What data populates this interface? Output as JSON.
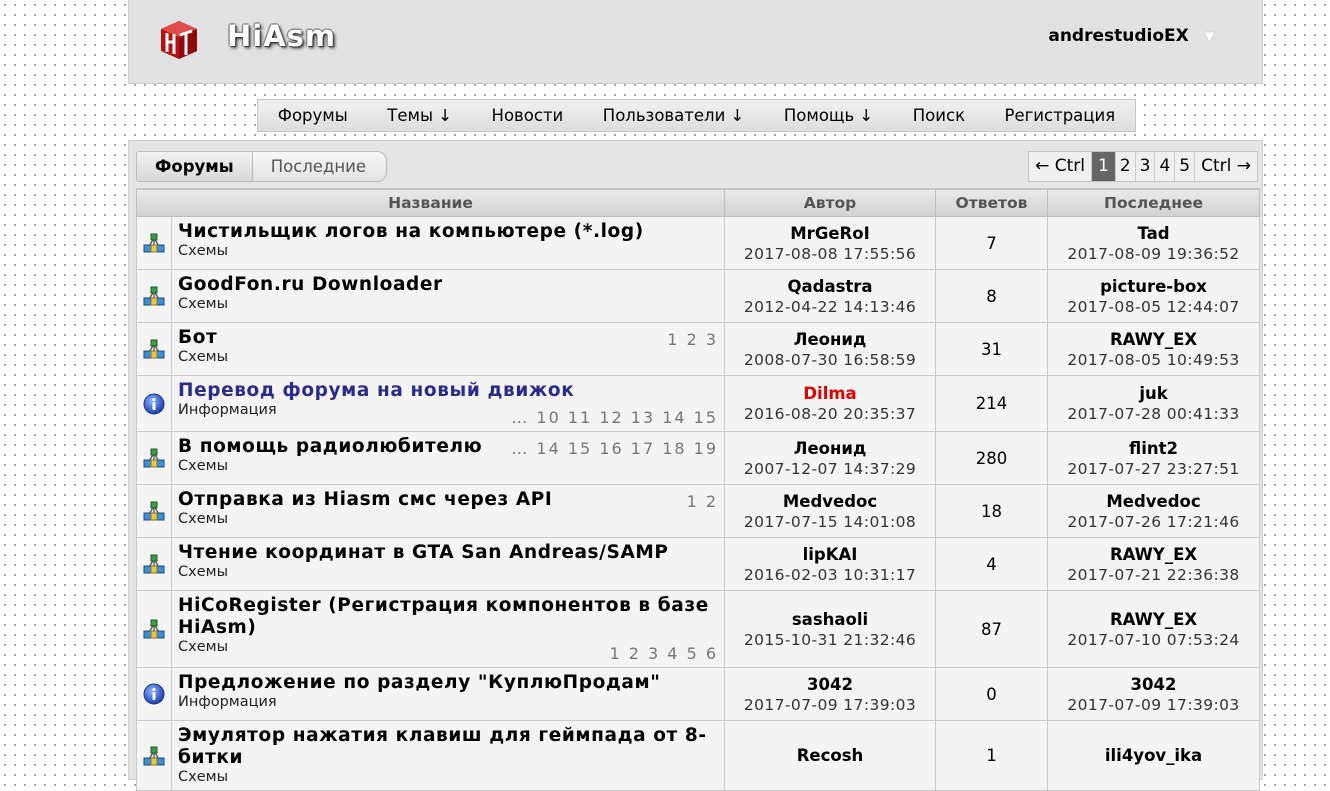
{
  "header": {
    "site_name": "HiAsm",
    "user_name": "andrestudioEX",
    "user_caret": "▼"
  },
  "nav": [
    "Форумы",
    "Темы ↓",
    "Новости",
    "Пользователи ↓",
    "Помощь ↓",
    "Поиск",
    "Регистрация"
  ],
  "tabs": {
    "active": "Форумы",
    "other": "Последние"
  },
  "pager": {
    "prev": "← Ctrl",
    "pages": [
      "1",
      "2",
      "3",
      "4",
      "5"
    ],
    "current": "1",
    "next": "Ctrl →"
  },
  "table": {
    "headers": [
      "Название",
      "Автор",
      "Ответов",
      "Последнее"
    ],
    "rows": [
      {
        "icon": "schema",
        "title": "Чистильщик логов на компьютере (*.log)",
        "category": "Схемы",
        "pages": "",
        "pages_pos": "top",
        "author": "MrGeRoI",
        "author_color": "",
        "created": "2017-08-08 17:55:56",
        "replies": "7",
        "last_user": "Tad",
        "last_date": "2017-08-09 19:36:52"
      },
      {
        "icon": "schema",
        "title": "GoodFon.ru Downloader",
        "category": "Схемы",
        "pages": "",
        "pages_pos": "top",
        "author": "Qadastra",
        "author_color": "",
        "created": "2012-04-22 14:13:46",
        "replies": "8",
        "last_user": "picture-box",
        "last_date": "2017-08-05 12:44:07"
      },
      {
        "icon": "schema",
        "title": "Бот",
        "category": "Схемы",
        "pages": "1 2 3",
        "pages_pos": "top",
        "author": "Леонид",
        "author_color": "",
        "created": "2008-07-30 16:58:59",
        "replies": "31",
        "last_user": "RAWY_EX",
        "last_date": "2017-08-05 10:49:53"
      },
      {
        "icon": "info",
        "title": "Перевод форума на новый движок",
        "category": "Информация",
        "pages": "… 10 11 12 13 14 15",
        "pages_pos": "bottom",
        "title_color": "blue",
        "author": "Dilma",
        "author_color": "red",
        "created": "2016-08-20 20:35:37",
        "replies": "214",
        "last_user": "juk",
        "last_date": "2017-07-28 00:41:33"
      },
      {
        "icon": "schema",
        "title": "В помощь радиолюбителю",
        "category": "Схемы",
        "pages": "… 14 15 16 17 18 19",
        "pages_pos": "top",
        "author": "Леонид",
        "author_color": "",
        "created": "2007-12-07 14:37:29",
        "replies": "280",
        "last_user": "flint2",
        "last_date": "2017-07-27 23:27:51"
      },
      {
        "icon": "schema",
        "title": "Отправка из Hiasm смс через API",
        "category": "Схемы",
        "pages": "1 2",
        "pages_pos": "top",
        "author": "Medvedoc",
        "author_color": "",
        "created": "2017-07-15 14:01:08",
        "replies": "18",
        "last_user": "Medvedoc",
        "last_date": "2017-07-26 17:21:46"
      },
      {
        "icon": "schema",
        "title": "Чтение координат в GTA San Andreas/SAMP",
        "category": "Схемы",
        "pages": "",
        "pages_pos": "top",
        "author": "lipKAI",
        "author_color": "",
        "created": "2016-02-03 10:31:17",
        "replies": "4",
        "last_user": "RAWY_EX",
        "last_date": "2017-07-21 22:36:38"
      },
      {
        "icon": "schema",
        "title": "HiCoRegister (Регистрация компонентов в базе HiAsm)",
        "category": "Схемы",
        "pages": "1 2 3 4 5 6",
        "pages_pos": "bottom",
        "author": "sashaoli",
        "author_color": "",
        "created": "2015-10-31 21:32:46",
        "replies": "87",
        "last_user": "RAWY_EX",
        "last_date": "2017-07-10 07:53:24"
      },
      {
        "icon": "info",
        "title": "Предложение по разделу \"КуплюПродам\"",
        "category": "Информация",
        "pages": "",
        "pages_pos": "top",
        "author": "3042",
        "author_color": "",
        "created": "2017-07-09 17:39:03",
        "replies": "0",
        "last_user": "3042",
        "last_date": "2017-07-09 17:39:03"
      },
      {
        "icon": "schema",
        "title": "Эмулятор нажатия клавиш для геймпада от 8-битки",
        "category": "Схемы",
        "pages": "",
        "pages_pos": "top",
        "author": "Recosh",
        "author_color": "",
        "created": "",
        "replies": "1",
        "last_user": "ili4yov_ika",
        "last_date": ""
      }
    ]
  }
}
